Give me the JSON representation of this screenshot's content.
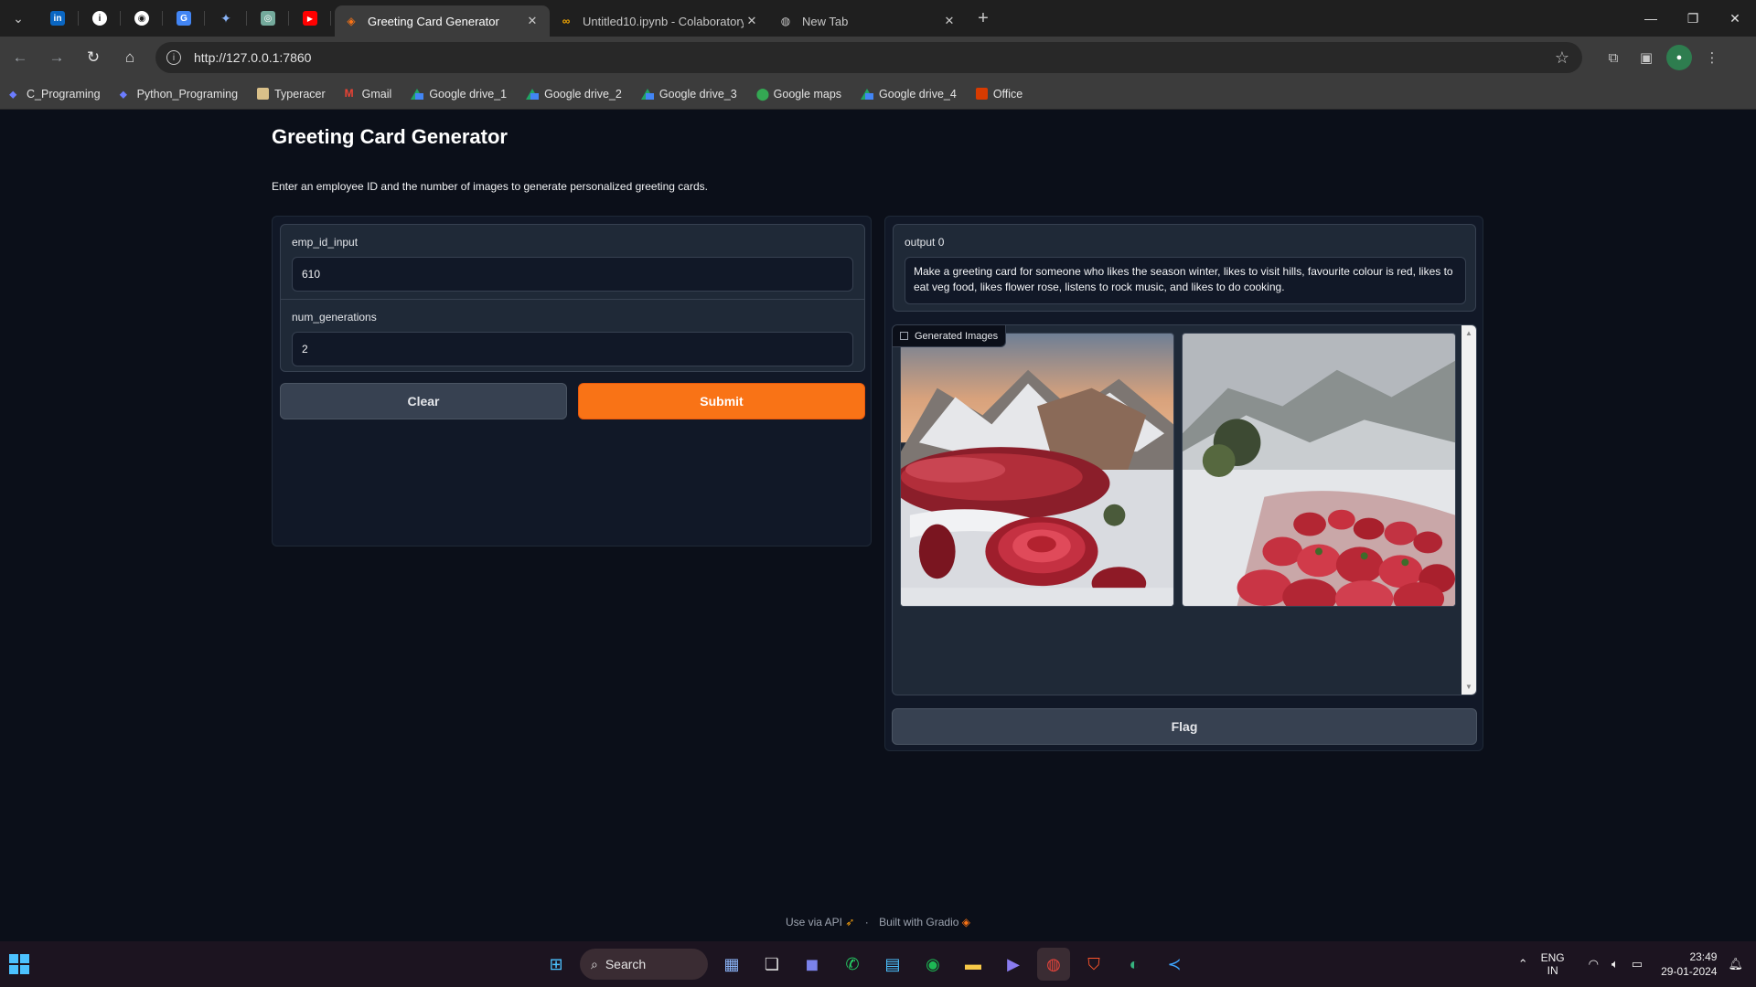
{
  "browser": {
    "tabs": [
      {
        "title": "Greeting Card Generator",
        "active": true
      },
      {
        "title": "Untitled10.ipynb - Colaboratory",
        "active": false
      },
      {
        "title": "New Tab",
        "active": false
      }
    ],
    "url": "http://127.0.0.1:7860",
    "bookmarks": [
      "C_Programing",
      "Python_Programing",
      "Typeracer",
      "Gmail",
      "Google drive_1",
      "Google drive_2",
      "Google drive_3",
      "Google maps",
      "Google drive_4",
      "Office"
    ]
  },
  "app": {
    "title": "Greeting Card Generator",
    "description": "Enter an employee ID and the number of images to generate personalized greeting cards.",
    "inputs": {
      "emp_label": "emp_id_input",
      "emp_value": "610",
      "num_label": "num_generations",
      "num_value": "2"
    },
    "buttons": {
      "clear": "Clear",
      "submit": "Submit",
      "flag": "Flag"
    },
    "output": {
      "label": "output 0",
      "text": "Make a greeting card for someone who likes the season winter, likes to visit hills, favourite colour is red, likes to eat veg food, likes flower rose, listens to rock music, and likes to do cooking."
    },
    "gallery": {
      "label": "Generated Images",
      "count": 2
    },
    "footer": {
      "api": "Use via API",
      "built": "Built with Gradio"
    }
  },
  "taskbar": {
    "search": "Search",
    "lang_top": "ENG",
    "lang_bottom": "IN",
    "time": "23:49",
    "date": "29-01-2024"
  },
  "colors": {
    "accent": "#f97316",
    "background": "#0b0f19",
    "panel": "#1f2937"
  }
}
